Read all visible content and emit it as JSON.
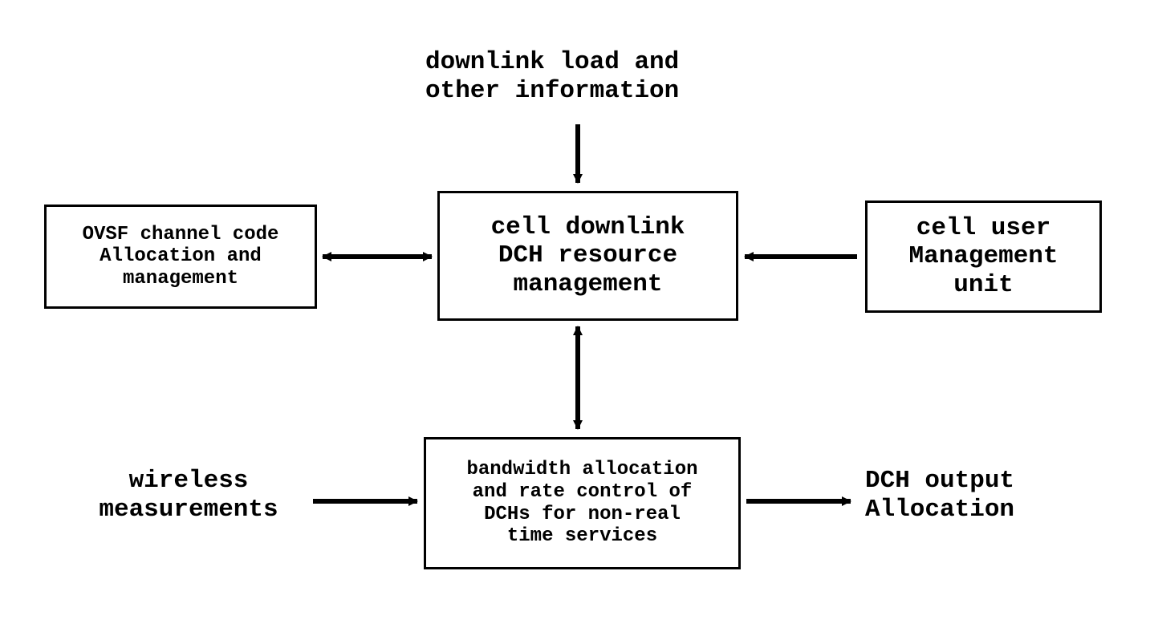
{
  "diagram": {
    "top_label": "downlink load and\nother information",
    "boxes": {
      "ovsf": "OVSF channel code\nAllocation and\nmanagement",
      "center": "cell downlink\nDCH resource\nmanagement",
      "user": "cell user\nManagement\nunit",
      "rate": "bandwidth allocation\nand rate control of\nDCHs for non-real\ntime services"
    },
    "left_label": "wireless\nmeasurements",
    "right_label": "DCH output\nAllocation"
  }
}
